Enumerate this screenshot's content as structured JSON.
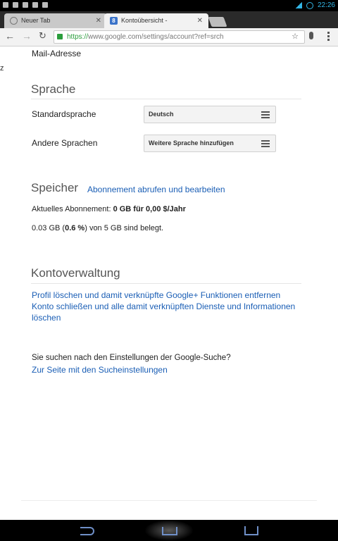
{
  "statusbar": {
    "time": "22:26",
    "icons": [
      "notification-icon",
      "gallery-icon",
      "usb-icon",
      "screenshot-icon",
      "play-icon",
      "signal-icon",
      "battery-icon"
    ]
  },
  "tabs": [
    {
      "label": "Neuer Tab",
      "active": false
    },
    {
      "label": "Kontoübersicht -",
      "active": true
    }
  ],
  "toolbar": {
    "url_scheme": "https://",
    "url_rest": "www.google.com/settings/account?ref=srch"
  },
  "page": {
    "stray_char": "z",
    "top_label": "Mail-Adresse",
    "sprache": {
      "heading": "Sprache",
      "rows": [
        {
          "label": "Standardsprache",
          "value": "Deutsch"
        },
        {
          "label": "Andere Sprachen",
          "value": "Weitere Sprache hinzufügen"
        }
      ]
    },
    "speicher": {
      "heading": "Speicher",
      "link": "Abonnement abrufen und bearbeiten",
      "subscription_prefix": "Aktuelles Abonnement: ",
      "subscription_value": "0 GB für 0,00 $/Jahr",
      "usage_prefix": "0.03 GB (",
      "usage_percent": "0.6 %",
      "usage_suffix": ") von 5 GB sind belegt."
    },
    "kontoverwaltung": {
      "heading": "Kontoverwaltung",
      "links": [
        "Profil löschen und damit verknüpfte Google+ Funktionen entfernen",
        "Konto schließen und alle damit verknüpften Dienste und Informationen löschen"
      ]
    },
    "search_settings": {
      "question": "Sie suchen nach den Einstellungen der Google-Suche?",
      "link": "Zur Seite mit den Sucheinstellungen"
    }
  },
  "colors": {
    "link": "#1a5eb5",
    "status_accent": "#33b5e5",
    "secure_green": "#2a9d3c"
  }
}
